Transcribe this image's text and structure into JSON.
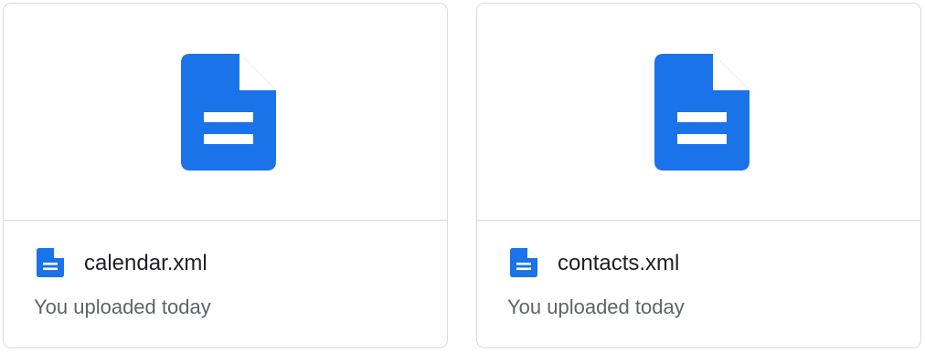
{
  "files": [
    {
      "name": "calendar.xml",
      "subtitle": "You uploaded today",
      "icon": "doc-file-icon"
    },
    {
      "name": "contacts.xml",
      "subtitle": "You uploaded today",
      "icon": "doc-file-icon"
    }
  ],
  "colors": {
    "icon_blue": "#1a73e8",
    "border": "#dadce0",
    "text_primary": "#202124",
    "text_secondary": "#5f6368"
  }
}
